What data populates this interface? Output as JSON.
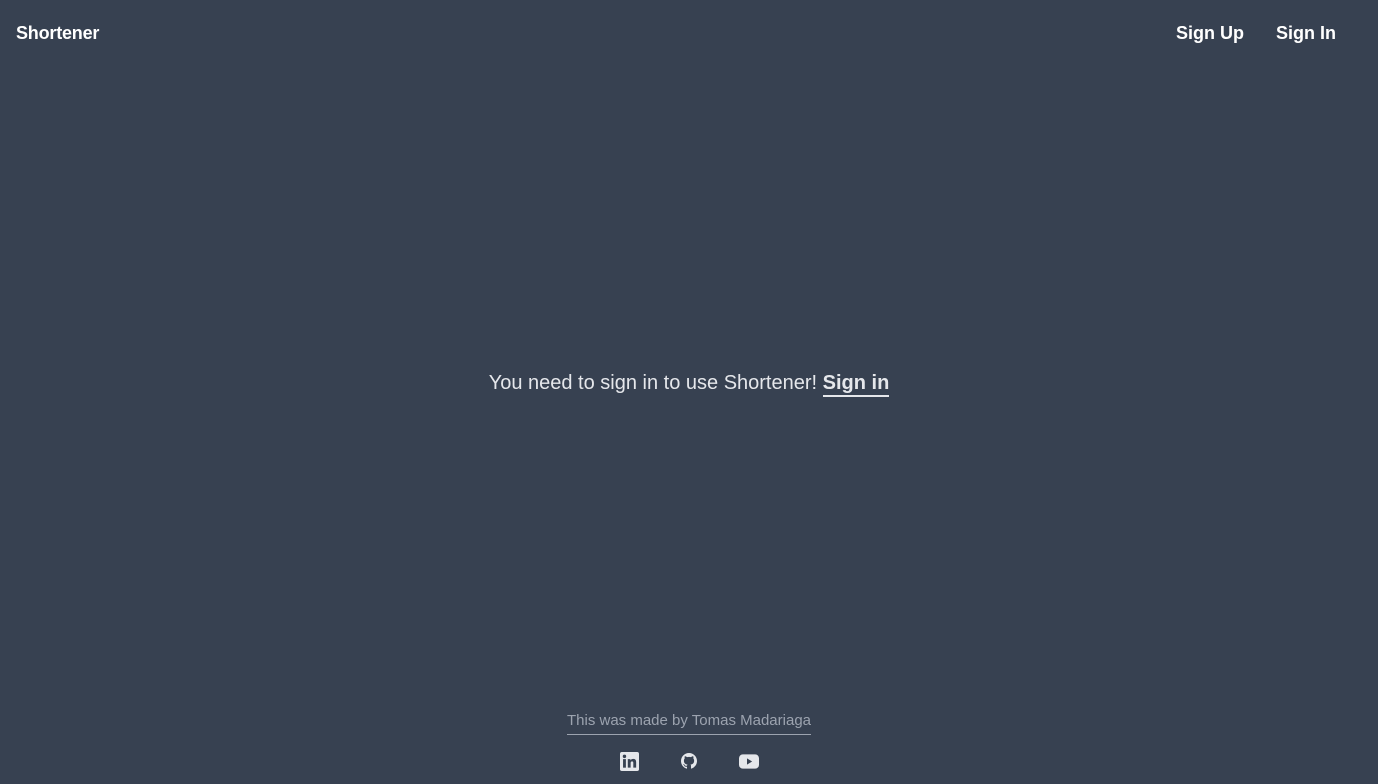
{
  "header": {
    "brand": "Shortener",
    "nav": {
      "sign_up": "Sign Up",
      "sign_in": "Sign In"
    }
  },
  "main": {
    "message": "You need to sign in to use Shortener!",
    "sign_in_link": "Sign in"
  },
  "footer": {
    "credit": "This was made by Tomas Madariaga",
    "social": [
      {
        "icon": "linkedin-icon"
      },
      {
        "icon": "github-icon"
      },
      {
        "icon": "youtube-icon"
      }
    ]
  },
  "colors": {
    "background": "#374151",
    "text": "#ffffff",
    "muted_text": "#9ca3af",
    "icon": "#e5e7eb"
  }
}
